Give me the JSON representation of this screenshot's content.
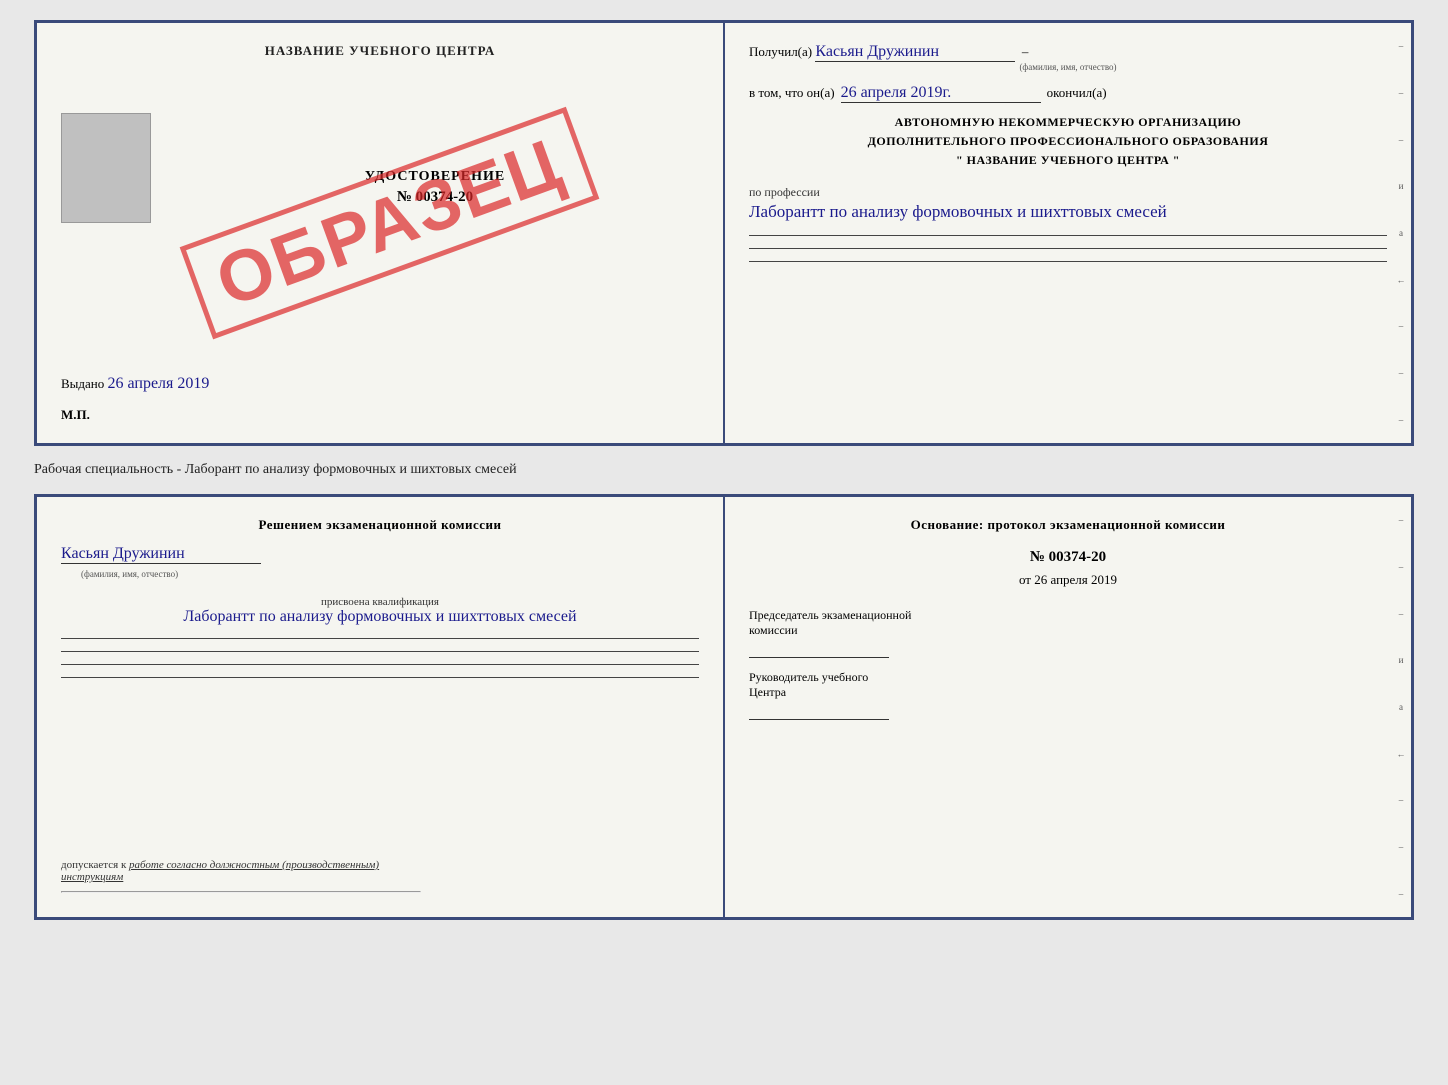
{
  "top_doc": {
    "left": {
      "title": "НАЗВАНИЕ УЧЕБНОГО ЦЕНТРА",
      "stamp": "ОБРАЗЕЦ",
      "udostoverenie": "УДОСТОВЕРЕНИЕ",
      "number": "№ 00374-20",
      "vydano_label": "Выдано",
      "vydano_date": "26 апреля 2019",
      "mp": "М.П."
    },
    "right": {
      "poluchil_prefix": "Получил(а)",
      "name_handwritten": "Касьян Дружинин",
      "name_caption": "(фамилия, имя, отчество)",
      "vtom_prefix": "в том, что он(а)",
      "vtom_date": "26 апреля 2019г.",
      "okonchil": "окончил(а)",
      "org_line1": "АВТОНОМНУЮ НЕКОММЕРЧЕСКУЮ ОРГАНИЗАЦИЮ",
      "org_line2": "ДОПОЛНИТЕЛЬНОГО ПРОФЕССИОНАЛЬНОГО ОБРАЗОВАНИЯ",
      "org_line3": "\"   НАЗВАНИЕ УЧЕБНОГО ЦЕНТРА   \"",
      "po_professii_label": "по профессии",
      "profession_handwritten": "Лаборантт по анализу формовочных и шихттовых смесей",
      "margin_chars": [
        "–",
        "–",
        "–",
        "и",
        "а",
        "←",
        "–",
        "–",
        "–"
      ]
    }
  },
  "middle": {
    "label": "Рабочая специальность - Лаборант по анализу формовочных и шихтовых смесей"
  },
  "bottom_doc": {
    "left": {
      "resheniem": "Решением экзаменационной комиссии",
      "name_handwritten": "Касьян Дружинин",
      "familiya_caption": "(фамилия, имя, отчество)",
      "prisvoena_label": "присвоена квалификация",
      "prisvoena_handwritten": "Лаборантт по анализу формовочных и шихттовых смесей",
      "dopuskaetsya_prefix": "допускается к",
      "dopuskaetsya_text": "работе согласно должностным (производственным) инструкциям"
    },
    "right": {
      "osnovanie": "Основание: протокол экзаменационной комиссии",
      "number": "№ 00374-20",
      "ot_prefix": "от",
      "ot_date": "26 апреля 2019",
      "predsedatel_line1": "Председатель экзаменационной",
      "predsedatel_line2": "комиссии",
      "rukovoditel_line1": "Руководитель учебного",
      "rukovoditel_line2": "Центра",
      "margin_chars": [
        "–",
        "–",
        "–",
        "и",
        "а",
        "←",
        "–",
        "–",
        "–"
      ]
    }
  }
}
